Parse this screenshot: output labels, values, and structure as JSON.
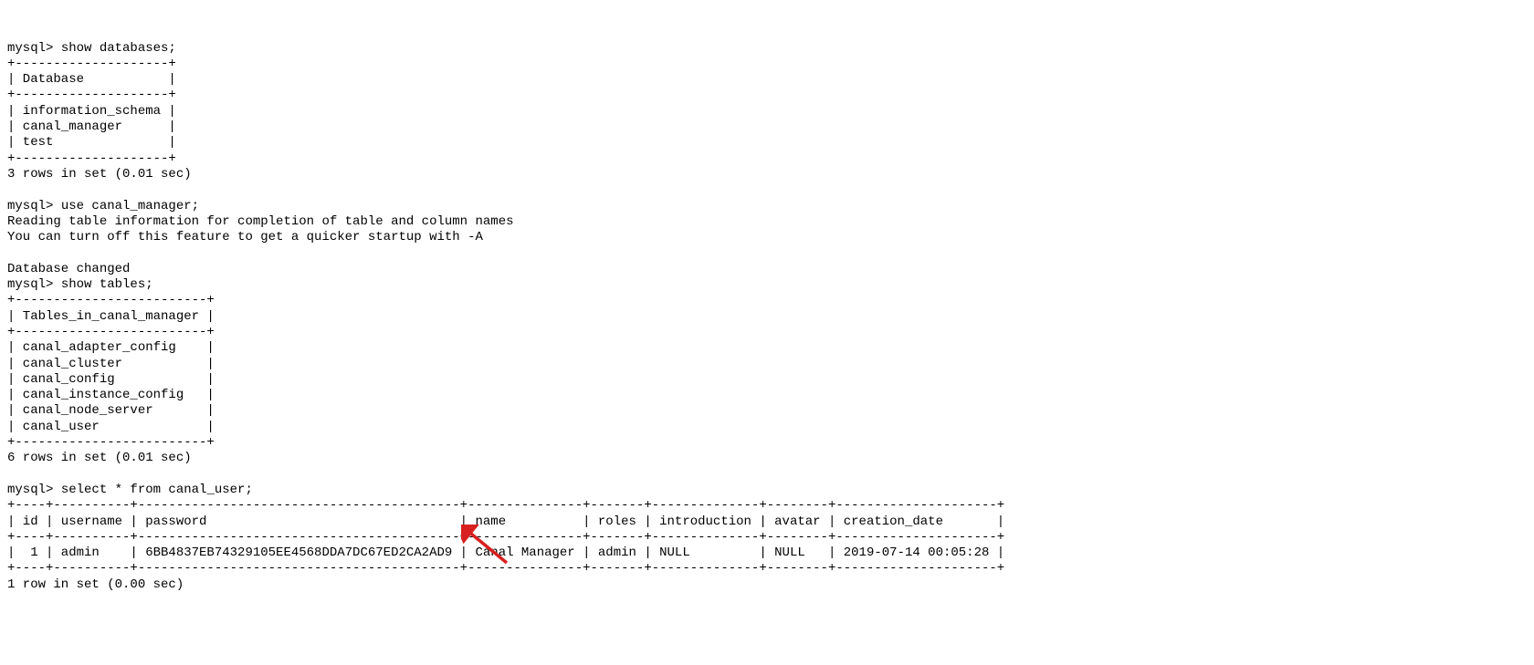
{
  "prompt": "mysql> ",
  "cmd1": "show databases;",
  "db_sep": "+--------------------+",
  "db_header": "| Database           |",
  "db_rows": [
    "| information_schema |",
    "| canal_manager      |",
    "| test               |"
  ],
  "db_summary": "3 rows in set (0.01 sec)",
  "cmd2": "use canal_manager;",
  "use_msg1": "Reading table information for completion of table and column names",
  "use_msg2": "You can turn off this feature to get a quicker startup with -A",
  "use_msg3": "Database changed",
  "cmd3": "show tables;",
  "tbl_sep": "+-------------------------+",
  "tbl_header": "| Tables_in_canal_manager |",
  "tbl_rows": [
    "| canal_adapter_config    |",
    "| canal_cluster           |",
    "| canal_config            |",
    "| canal_instance_config   |",
    "| canal_node_server       |",
    "| canal_user              |"
  ],
  "tbl_summary": "6 rows in set (0.01 sec)",
  "cmd4": "select * from canal_user;",
  "user_sep": "+----+----------+------------------------------------------+---------------+-------+--------------+--------+---------------------+",
  "user_header": "| id | username | password                                 | name          | roles | introduction | avatar | creation_date       |",
  "user_row": "|  1 | admin    | 6BB4837EB74329105EE4568DDA7DC67ED2CA2AD9 | Canal Manager | admin | NULL         | NULL   | 2019-07-14 00:05:28 |",
  "user_summary": "1 row in set (0.00 sec)",
  "chart_data": {
    "type": "table",
    "queries": [
      {
        "sql": "show databases;",
        "columns": [
          "Database"
        ],
        "rows": [
          [
            "information_schema"
          ],
          [
            "canal_manager"
          ],
          [
            "test"
          ]
        ],
        "rows_in_set": 3,
        "elapsed_sec": 0.01
      },
      {
        "sql": "use canal_manager;",
        "messages": [
          "Reading table information for completion of table and column names",
          "You can turn off this feature to get a quicker startup with -A",
          "Database changed"
        ]
      },
      {
        "sql": "show tables;",
        "columns": [
          "Tables_in_canal_manager"
        ],
        "rows": [
          [
            "canal_adapter_config"
          ],
          [
            "canal_cluster"
          ],
          [
            "canal_config"
          ],
          [
            "canal_instance_config"
          ],
          [
            "canal_node_server"
          ],
          [
            "canal_user"
          ]
        ],
        "rows_in_set": 6,
        "elapsed_sec": 0.01
      },
      {
        "sql": "select * from canal_user;",
        "columns": [
          "id",
          "username",
          "password",
          "name",
          "roles",
          "introduction",
          "avatar",
          "creation_date"
        ],
        "rows": [
          [
            1,
            "admin",
            "6BB4837EB74329105EE4568DDA7DC67ED2CA2AD9",
            "Canal Manager",
            "admin",
            "NULL",
            "NULL",
            "2019-07-14 00:05:28"
          ]
        ],
        "rows_in_set": 1,
        "elapsed_sec": 0.0
      }
    ]
  }
}
